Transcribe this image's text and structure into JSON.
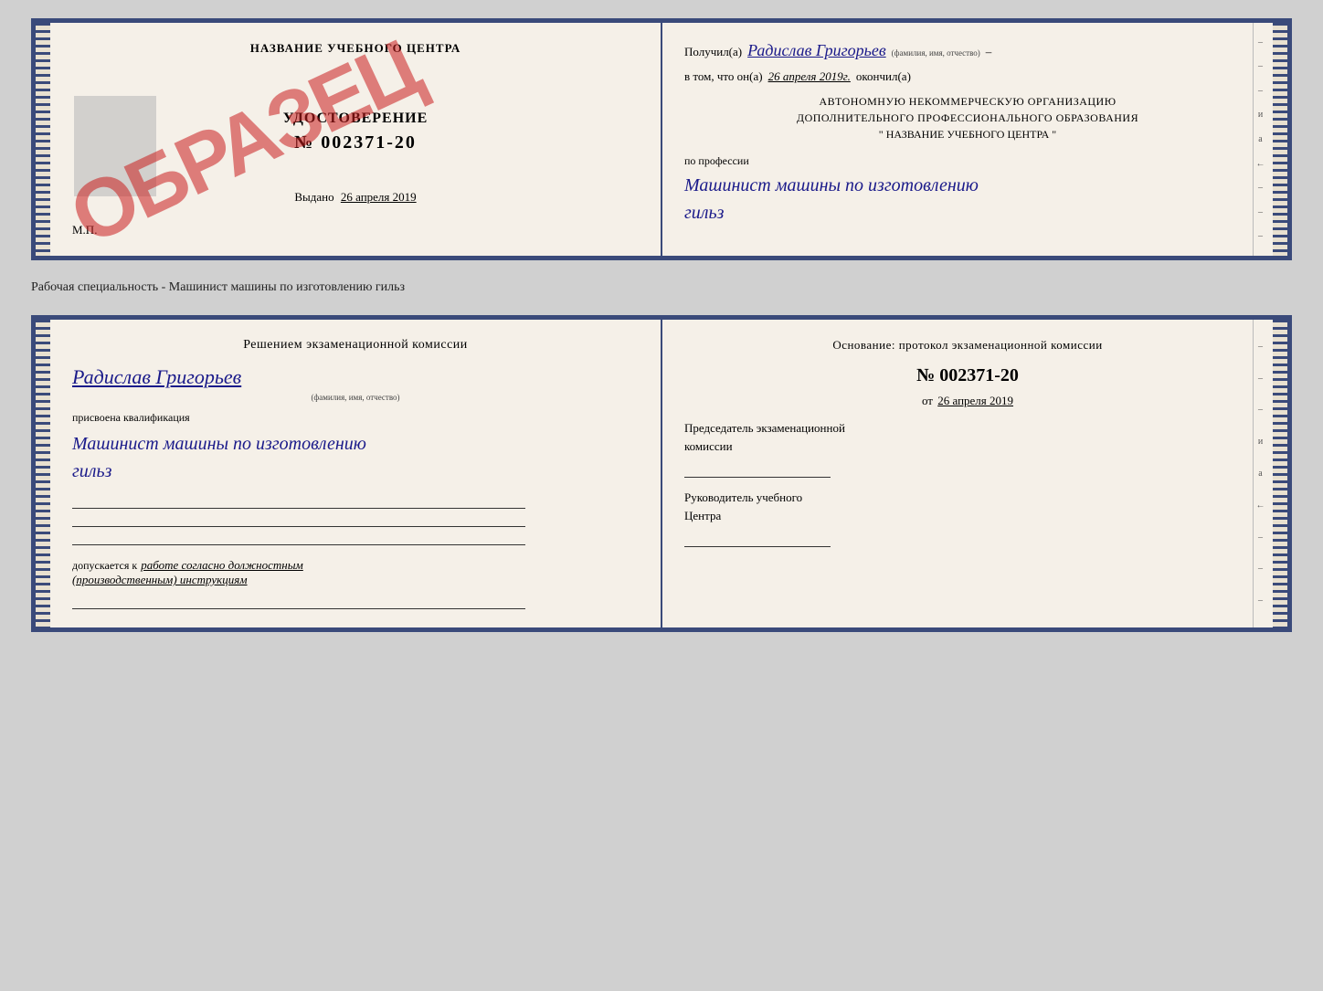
{
  "top_doc": {
    "left": {
      "title": "НАЗВАНИЕ УЧЕБНОГО ЦЕНТРА",
      "cert_label": "УДОСТОВЕРЕНИЕ",
      "cert_number": "№ 002371-20",
      "issued_label": "Выдано",
      "issued_date": "26 апреля 2019",
      "mp_label": "М.П.",
      "obrazec": "ОБРАЗЕЦ"
    },
    "right": {
      "received_label": "Получил(а)",
      "recipient_name": "Радислав Григорьев",
      "fio_hint": "(фамилия, имя, отчество)",
      "dash1": "–",
      "in_that_label": "в том, что он(а)",
      "completion_date": "26 апреля 2019г.",
      "finished_label": "окончил(а)",
      "org_line1": "АВТОНОМНУЮ НЕКОММЕРЧЕСКУЮ ОРГАНИЗАЦИЮ",
      "org_line2": "ДОПОЛНИТЕЛЬНОГО ПРОФЕССИОНАЛЬНОГО ОБРАЗОВАНИЯ",
      "org_quote_open": "\"",
      "org_name_center": "НАЗВАНИЕ УЧЕБНОГО ЦЕНТРА",
      "org_quote_close": "\"",
      "profession_label": "по профессии",
      "profession_name_line1": "Машинист машины по изготовлению",
      "profession_name_line2": "гильз"
    }
  },
  "separator": {
    "text": "Рабочая специальность - Машинист машины по изготовлению гильз"
  },
  "bottom_doc": {
    "left": {
      "decision_title": "Решением  экзаменационной  комиссии",
      "person_name": "Радислав Григорьев",
      "fio_sub": "(фамилия, имя, отчество)",
      "assigned_label": "присвоена квалификация",
      "qualification_line1": "Машинист  машины  по  изготовлению",
      "qualification_line2": "гильз",
      "allowed_label": "допускается к",
      "allowed_cursive": "работе согласно должностным",
      "allowed_cursive2": "(производственным) инструкциям"
    },
    "right": {
      "basis_title": "Основание: протокол экзаменационной  комиссии",
      "protocol_number": "№  002371-20",
      "protocol_date_prefix": "от",
      "protocol_date": "26 апреля 2019",
      "commission_chair": "Председатель экзаменационной",
      "commission_chair2": "комиссии",
      "center_leader": "Руководитель учебного",
      "center_leader2": "Центра"
    }
  },
  "right_marks": {
    "marks": [
      "–",
      "–",
      "–",
      "и",
      "а",
      "←",
      "–",
      "–",
      "–"
    ]
  }
}
